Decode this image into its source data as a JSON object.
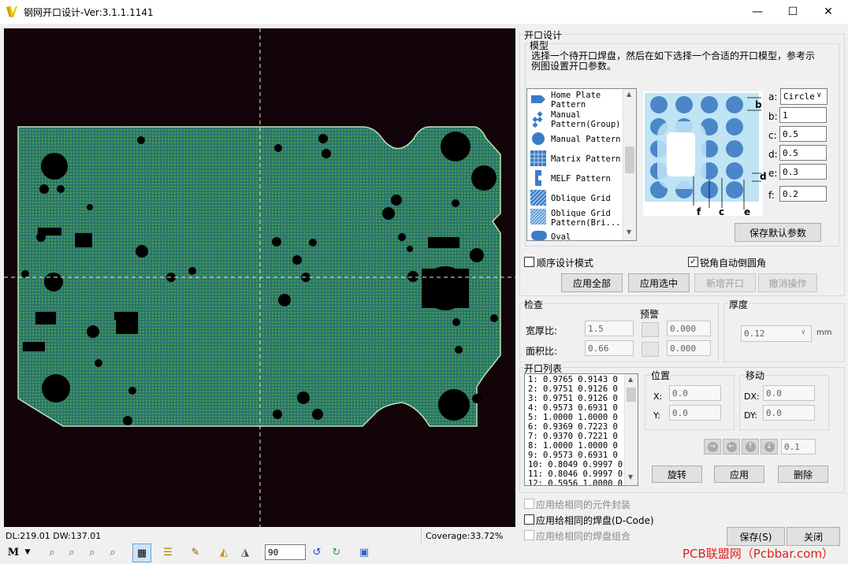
{
  "window": {
    "title": "钢网开口设计-Ver:3.1.1.1141",
    "min": "—",
    "max": "☐",
    "close": "✕"
  },
  "status": {
    "dl_dw": "DL:219.01 DW:137.01",
    "coverage": "Coverage:33.72%"
  },
  "toolbar": {
    "zoom_value": "90"
  },
  "design": {
    "group_title": "开口设计",
    "model_title": "模型",
    "instruction": "选择一个待开口焊盘，然后在如下选择一个合适的开口模型，参考示例图设置开口参数。",
    "patterns": [
      {
        "label": "Home Plate Pattern",
        "icon": "home-plate-icon"
      },
      {
        "label": "Manual Pattern(Group)",
        "icon": "manual-group-icon"
      },
      {
        "label": "Manual Pattern",
        "icon": "circle-icon"
      },
      {
        "label": "Matrix Pattern",
        "icon": "matrix-icon"
      },
      {
        "label": "MELF Pattern",
        "icon": "melf-icon"
      },
      {
        "label": "Oblique Grid",
        "icon": "oblique-grid-icon"
      },
      {
        "label": "Oblique Grid Pattern(Bri...",
        "icon": "oblique-bridge-icon"
      },
      {
        "label": "Oval",
        "icon": "oval-icon"
      }
    ],
    "diagram_labels": {
      "b": "b",
      "c": "c",
      "d": "d",
      "e": "e",
      "f": "f"
    },
    "params": [
      {
        "label": "a:",
        "value": "Circle"
      },
      {
        "label": "b:",
        "value": "1"
      },
      {
        "label": "c:",
        "value": "0.5"
      },
      {
        "label": "d:",
        "value": "0.5"
      },
      {
        "label": "e:",
        "value": "0.3"
      },
      {
        "label": "f:",
        "value": "0.2"
      }
    ],
    "save_default": "保存默认参数",
    "sequential_mode": "顺序设计模式",
    "auto_round": "锐角自动倒圆角",
    "apply_all": "应用全部",
    "apply_selected": "应用选中",
    "new_aperture": "新增开口",
    "undo": "撤消操作"
  },
  "check": {
    "title": "检查",
    "warning_title": "预警",
    "aspect_ratio_label": "宽厚比:",
    "aspect_ratio_value": "1.5",
    "aspect_warn_value": "0.000",
    "area_ratio_label": "面积比:",
    "area_ratio_value": "0.66",
    "area_warn_value": "0.000"
  },
  "thickness": {
    "title": "厚度",
    "value": "0.12",
    "unit": "mm"
  },
  "aperture_list": {
    "title": "开口列表",
    "rows": [
      "1: 0.9765 0.9143 0",
      "2: 0.9751 0.9126 0",
      "3: 0.9751 0.9126 0",
      "4: 0.9573 0.6931 0",
      "5: 1.0000 1.0000 0",
      "6: 0.9369 0.7223 0",
      "7: 0.9370 0.7221 0",
      "8: 1.0000 1.0000 0",
      "9: 0.9573 0.6931 0",
      "10: 0.8049 0.9997 0",
      "11: 0.8046 0.9997 0",
      "12: 0.5956 1.0000 0"
    ]
  },
  "position": {
    "title": "位置",
    "x_label": "X:",
    "x_value": "0.0",
    "y_label": "Y:",
    "y_value": "0.0"
  },
  "move": {
    "title": "移动",
    "dx_label": "DX:",
    "dx_value": "0.0",
    "dy_label": "DY:",
    "dy_value": "0.0",
    "step_value": "0.1"
  },
  "actions": {
    "rotate": "旋转",
    "apply": "应用",
    "delete": "删除"
  },
  "apply_options": {
    "same_footprint": "应用给相同的元件封装",
    "same_pad": "应用给相同的焊盘(D-Code)",
    "same_pad_group": "应用给相同的焊盘组合"
  },
  "footer": {
    "save": "保存(S)",
    "close": "关闭",
    "watermark": "PCB联盟网（Pcbbar.com）"
  },
  "colors": {
    "board": "#2a7a6a",
    "background": "#120408",
    "accent": "#2b78d4",
    "watermark": "#e0201c"
  }
}
